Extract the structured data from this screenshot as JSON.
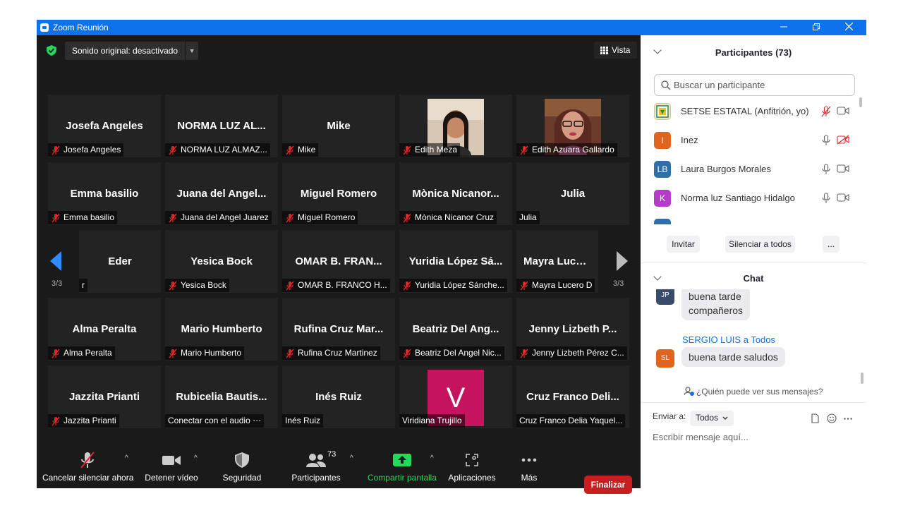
{
  "window": {
    "title": "Zoom Reunión"
  },
  "meeting": {
    "audio_label": "Sonido original: desactivado",
    "view_label": "Vista",
    "page_left": "3/3",
    "page_right": "3/3",
    "tiles": [
      {
        "name": "Josefa Angeles",
        "tag": "Josefa Angeles",
        "muted": true
      },
      {
        "name": "NORMA LUZ AL...",
        "tag": "NORMA LUZ ALMAZ...",
        "muted": true
      },
      {
        "name": "Mike",
        "tag": "Mike",
        "muted": true
      },
      {
        "name": "",
        "tag": "Edith Meza",
        "muted": true,
        "photo": "a"
      },
      {
        "name": "",
        "tag": "Edith Azuara Gallardo",
        "muted": true,
        "photo": "b"
      },
      {
        "name": "Emma basilio",
        "tag": "Emma basilio",
        "muted": true
      },
      {
        "name": "Juana del Angel...",
        "tag": "Juana del Angel Juarez",
        "muted": true
      },
      {
        "name": "Miguel Romero",
        "tag": "Miguel Romero",
        "muted": true
      },
      {
        "name": "Mònica  Nicanor...",
        "tag": "Mònica Nicanor Cruz",
        "muted": true
      },
      {
        "name": "Julia",
        "tag": "Julia",
        "muted": false
      },
      {
        "name": "Eder",
        "tag": "r",
        "muted": false
      },
      {
        "name": "Yesica Bock",
        "tag": "Yesica Bock",
        "muted": true
      },
      {
        "name": "OMAR B. FRAN...",
        "tag": "OMAR B. FRANCO H...",
        "muted": true
      },
      {
        "name": "Yuridia  López  Sá...",
        "tag": "Yuridia López Sánche...",
        "muted": true
      },
      {
        "name": "Mayra Lucero",
        "tag": "Mayra Lucero D",
        "muted": true
      },
      {
        "name": "Alma Peralta",
        "tag": "Alma Peralta",
        "muted": true
      },
      {
        "name": "Mario Humberto",
        "tag": "Mario Humberto",
        "muted": true
      },
      {
        "name": "Rufina  Cruz  Mar...",
        "tag": "Rufina Cruz Martinez",
        "muted": true
      },
      {
        "name": "Beatriz  Del  Ang...",
        "tag": "Beatriz Del Angel Nic...",
        "muted": true
      },
      {
        "name": "Jenny  Lizbeth  P...",
        "tag": "Jenny Lizbeth Pérez C...",
        "muted": true
      },
      {
        "name": "Jazzita Prianti",
        "tag": "Jazzita Prianti",
        "muted": true
      },
      {
        "name": "Rubicelia  Bautis...",
        "tag": "Conectar con el audio ⋯",
        "muted": false
      },
      {
        "name": "Inés Ruiz",
        "tag": "Inés Ruiz",
        "muted": false
      },
      {
        "name": "",
        "tag": "Viridiana Trujillo",
        "muted": false,
        "avatar_letter": "V"
      },
      {
        "name": "Cruz  Franco  Deli...",
        "tag": "Cruz Franco Delia Yaquel...",
        "muted": false
      }
    ]
  },
  "toolbar": {
    "unmute_label": "Cancelar silenciar ahora",
    "video_label": "Detener vídeo",
    "security_label": "Seguridad",
    "participants_label": "Participantes",
    "participants_count": "73",
    "share_label": "Compartir pantalla",
    "apps_label": "Aplicaciones",
    "more_label": "Más",
    "end_label": "Finalizar"
  },
  "participants": {
    "title": "Participantes (73)",
    "search_placeholder": "Buscar un participante",
    "list": [
      {
        "name": "SETSE ESTATAL (Anfitrión, yo)",
        "initials": "",
        "color": "#e8e6d0",
        "mic_muted": true,
        "video_off": false
      },
      {
        "name": "Inez",
        "initials": "I",
        "color": "#e0641e",
        "mic_muted": false,
        "video_off": true
      },
      {
        "name": "Laura Burgos Morales",
        "initials": "LB",
        "color": "#2d6fa6",
        "mic_muted": false,
        "video_off": false
      },
      {
        "name": "Norma luz Santiago Hidalgo",
        "initials": "K",
        "color": "#b43cc8",
        "mic_muted": false,
        "video_off": false
      }
    ],
    "invite_label": "Invitar",
    "mute_all_label": "Silenciar a todos",
    "more_label": "..."
  },
  "chat": {
    "title": "Chat",
    "messages": [
      {
        "initials": "JP",
        "color": "#394a6a",
        "text_line1": "buena tarde",
        "text_line2": "compañeros"
      },
      {
        "initials": "SL",
        "color": "#e0641e",
        "sender": "SERGIO LUIS",
        "to_word": "a",
        "recipient": "Todos",
        "text": "buena tarde saludos"
      }
    ],
    "who_can_see": "¿Quién puede ver sus mensajes?",
    "send_to_label": "Enviar a:",
    "send_to_value": "Todos",
    "input_placeholder": "Escribir mensaje aquí..."
  }
}
